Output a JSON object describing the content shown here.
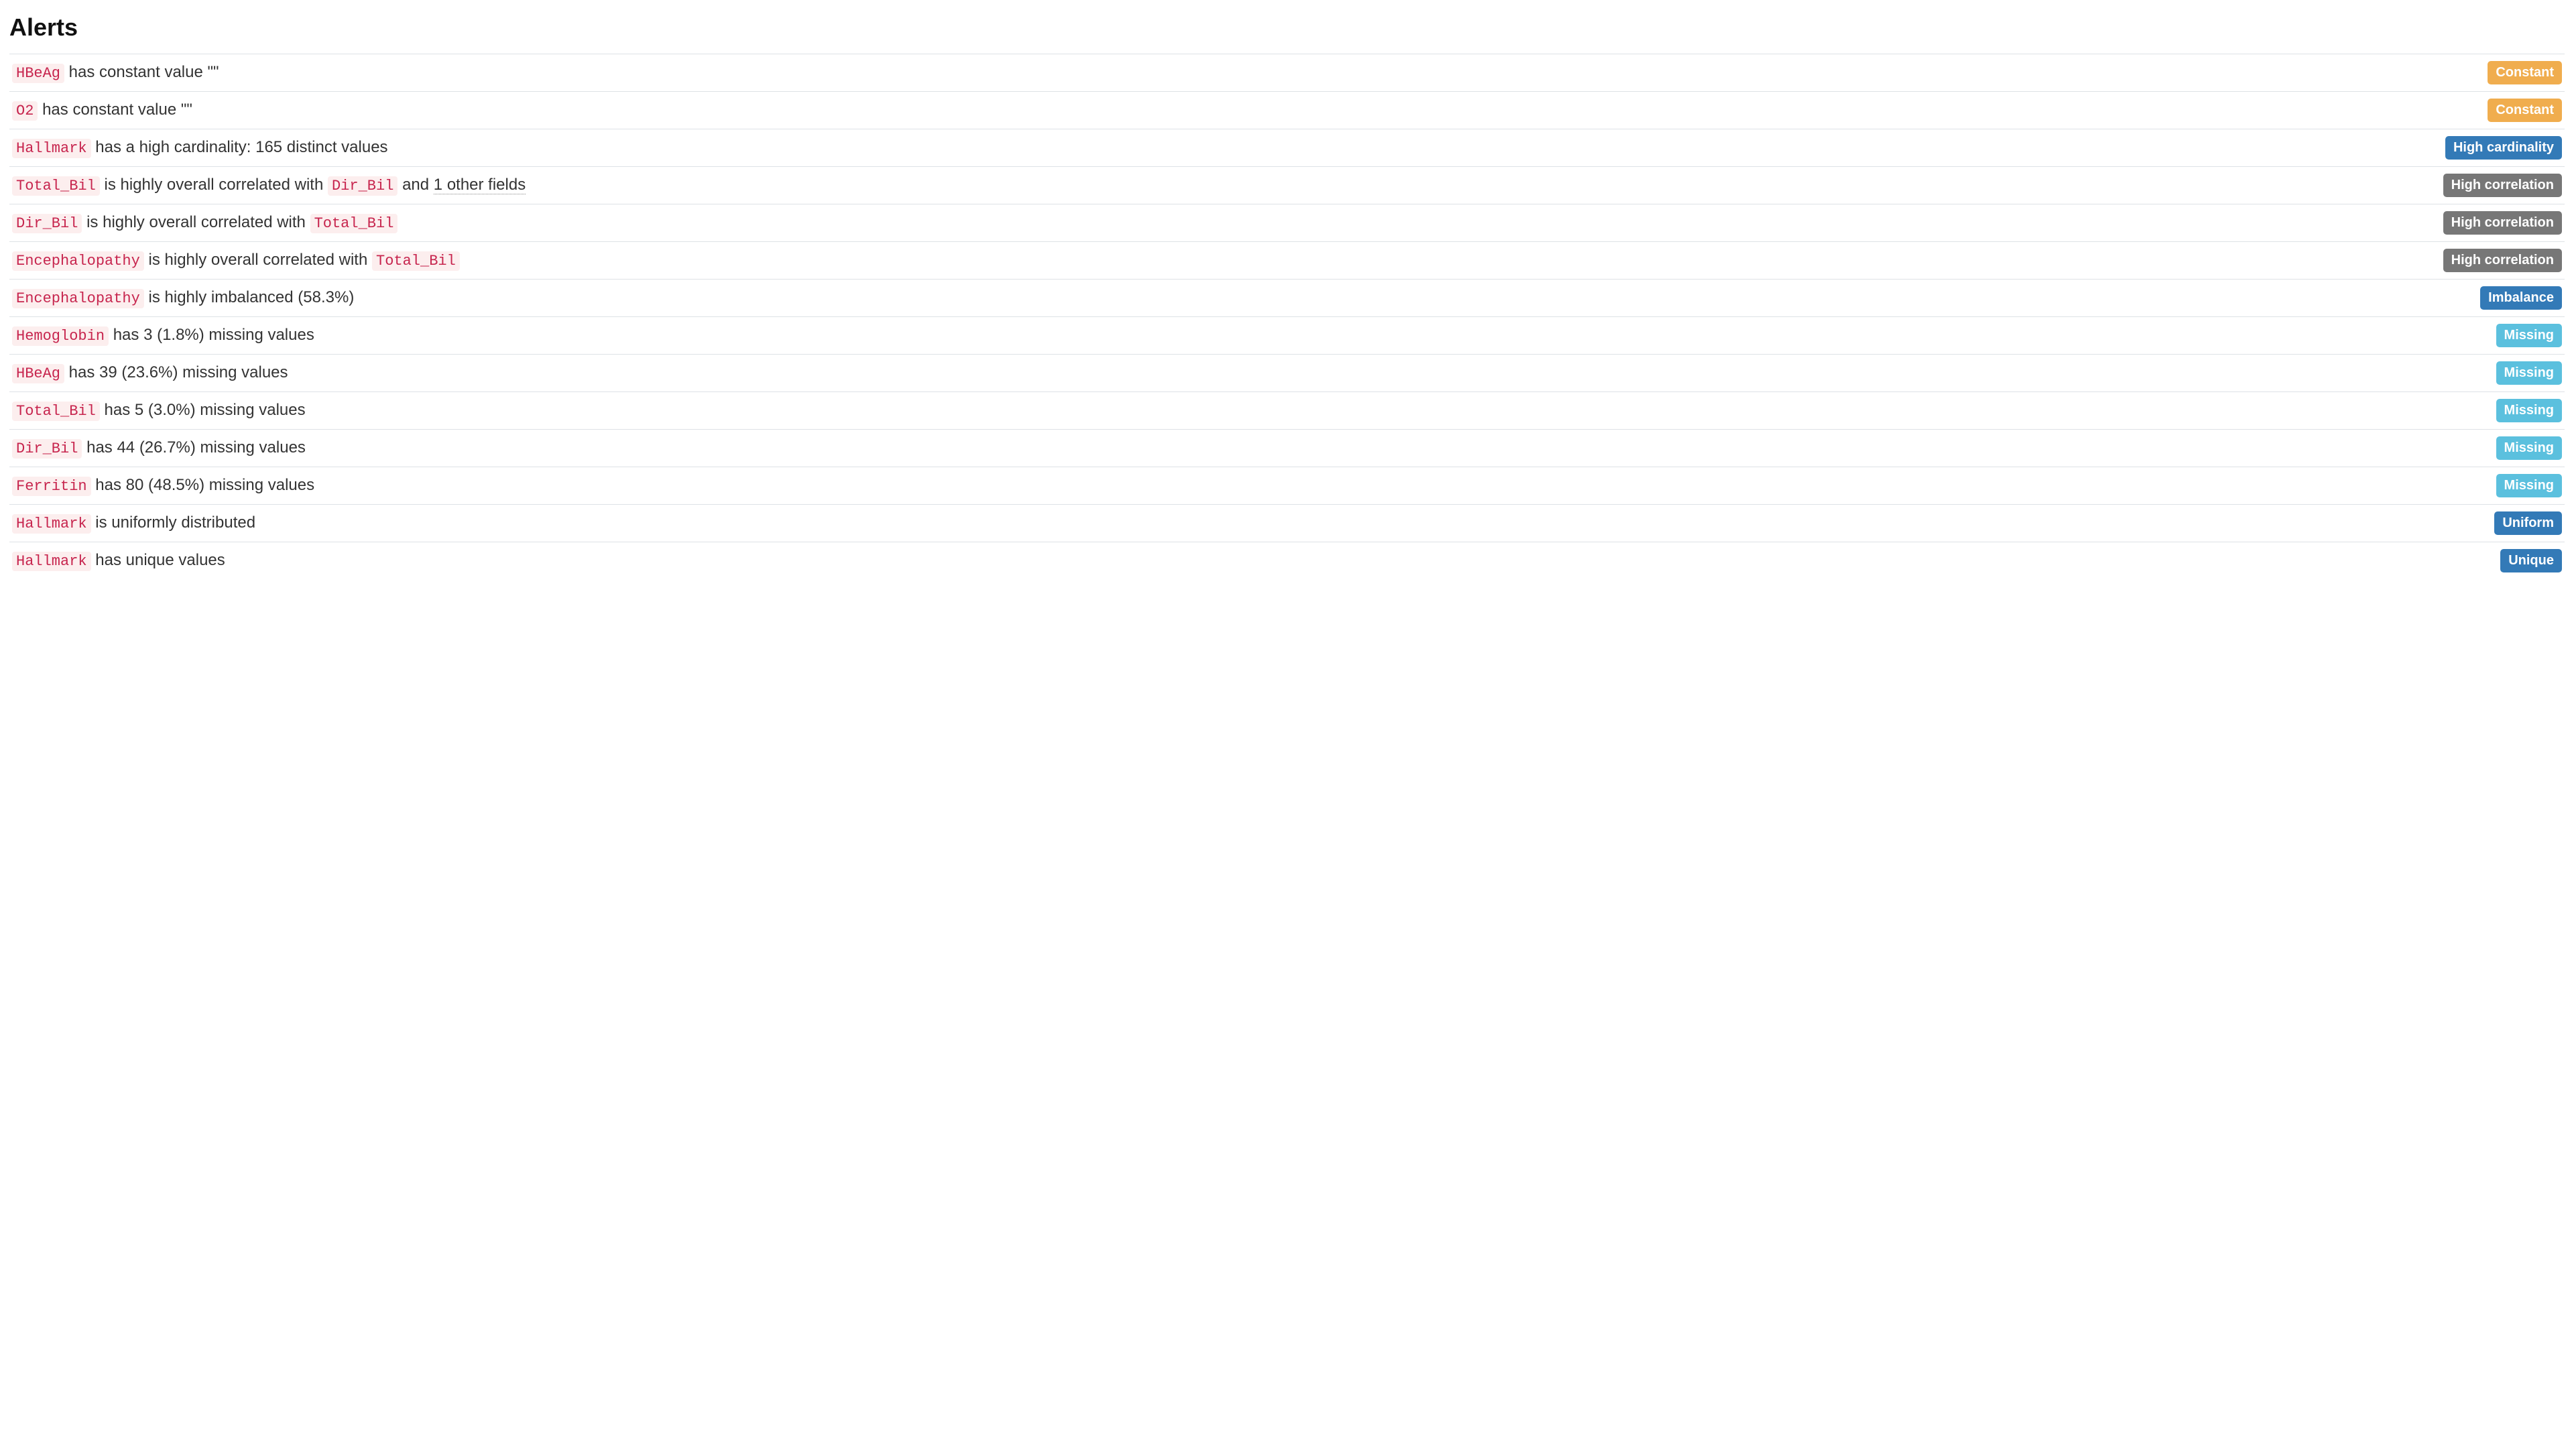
{
  "title": "Alerts",
  "badges": {
    "constant": "Constant",
    "high_cardinality": "High cardinality",
    "high_correlation": "High correlation",
    "imbalance": "Imbalance",
    "missing": "Missing",
    "uniform": "Uniform",
    "unique": "Unique"
  },
  "alerts": [
    {
      "vars": [
        "HBeAg"
      ],
      "segments": [
        {
          "t": "var",
          "v": "HBeAg"
        },
        {
          "t": "text",
          "v": " has constant value \"\""
        }
      ],
      "badge": "constant"
    },
    {
      "vars": [
        "O2"
      ],
      "segments": [
        {
          "t": "var",
          "v": "O2"
        },
        {
          "t": "text",
          "v": " has constant value \"\""
        }
      ],
      "badge": "constant"
    },
    {
      "vars": [
        "Hallmark"
      ],
      "segments": [
        {
          "t": "var",
          "v": "Hallmark"
        },
        {
          "t": "text",
          "v": " has a high cardinality: 165 distinct values"
        }
      ],
      "badge": "high_cardinality"
    },
    {
      "vars": [
        "Total_Bil",
        "Dir_Bil"
      ],
      "segments": [
        {
          "t": "var",
          "v": "Total_Bil"
        },
        {
          "t": "text",
          "v": " is highly overall correlated with "
        },
        {
          "t": "var",
          "v": "Dir_Bil"
        },
        {
          "t": "text",
          "v": " and "
        },
        {
          "t": "other",
          "v": "1 other fields"
        }
      ],
      "badge": "high_correlation"
    },
    {
      "vars": [
        "Dir_Bil",
        "Total_Bil"
      ],
      "segments": [
        {
          "t": "var",
          "v": "Dir_Bil"
        },
        {
          "t": "text",
          "v": " is highly overall correlated with "
        },
        {
          "t": "var",
          "v": "Total_Bil"
        }
      ],
      "badge": "high_correlation"
    },
    {
      "vars": [
        "Encephalopathy",
        "Total_Bil"
      ],
      "segments": [
        {
          "t": "var",
          "v": "Encephalopathy"
        },
        {
          "t": "text",
          "v": " is highly overall correlated with "
        },
        {
          "t": "var",
          "v": "Total_Bil"
        }
      ],
      "badge": "high_correlation"
    },
    {
      "vars": [
        "Encephalopathy"
      ],
      "segments": [
        {
          "t": "var",
          "v": "Encephalopathy"
        },
        {
          "t": "text",
          "v": " is highly imbalanced (58.3%)"
        }
      ],
      "badge": "imbalance"
    },
    {
      "vars": [
        "Hemoglobin"
      ],
      "segments": [
        {
          "t": "var",
          "v": "Hemoglobin"
        },
        {
          "t": "text",
          "v": " has 3 (1.8%) missing values"
        }
      ],
      "badge": "missing"
    },
    {
      "vars": [
        "HBeAg"
      ],
      "segments": [
        {
          "t": "var",
          "v": "HBeAg"
        },
        {
          "t": "text",
          "v": " has 39 (23.6%) missing values"
        }
      ],
      "badge": "missing"
    },
    {
      "vars": [
        "Total_Bil"
      ],
      "segments": [
        {
          "t": "var",
          "v": "Total_Bil"
        },
        {
          "t": "text",
          "v": " has 5 (3.0%) missing values"
        }
      ],
      "badge": "missing"
    },
    {
      "vars": [
        "Dir_Bil"
      ],
      "segments": [
        {
          "t": "var",
          "v": "Dir_Bil"
        },
        {
          "t": "text",
          "v": " has 44 (26.7%) missing values"
        }
      ],
      "badge": "missing"
    },
    {
      "vars": [
        "Ferritin"
      ],
      "segments": [
        {
          "t": "var",
          "v": "Ferritin"
        },
        {
          "t": "text",
          "v": " has 80 (48.5%) missing values"
        }
      ],
      "badge": "missing"
    },
    {
      "vars": [
        "Hallmark"
      ],
      "segments": [
        {
          "t": "var",
          "v": "Hallmark"
        },
        {
          "t": "text",
          "v": " is uniformly distributed"
        }
      ],
      "badge": "uniform"
    },
    {
      "vars": [
        "Hallmark"
      ],
      "segments": [
        {
          "t": "var",
          "v": "Hallmark"
        },
        {
          "t": "text",
          "v": " has unique values"
        }
      ],
      "badge": "unique"
    }
  ]
}
